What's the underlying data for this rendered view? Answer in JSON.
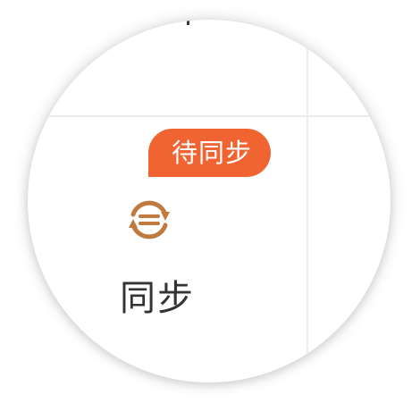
{
  "status_badge": {
    "label": "待同步",
    "color": "#f06431"
  },
  "sync_button": {
    "label": "同步",
    "icon": "sync-icon",
    "icon_color": "#c07a3f"
  }
}
